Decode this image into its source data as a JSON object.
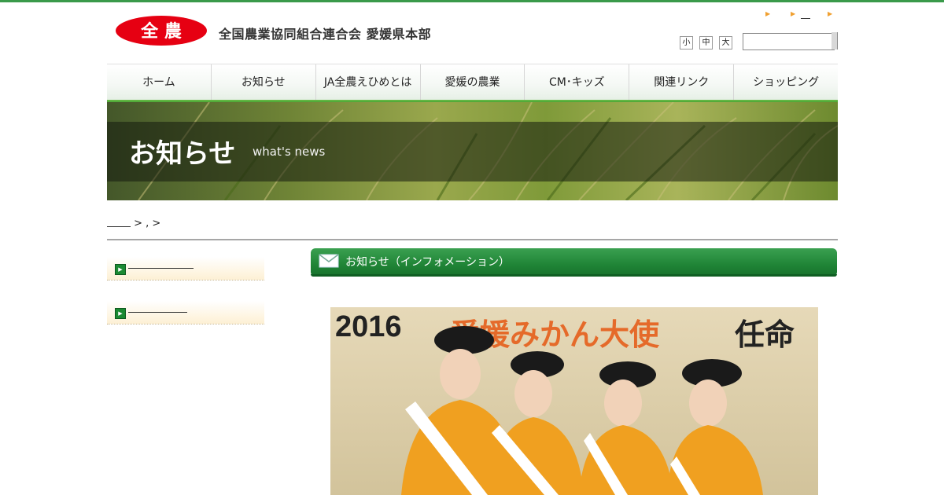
{
  "header": {
    "logo_text": "全 農",
    "org_name": "全国農業協同組合連合会 愛媛県本部",
    "font_size_label": [
      "小",
      "中",
      "大"
    ],
    "search_placeholder": ""
  },
  "nav": {
    "items": [
      "ホーム",
      "お知らせ",
      "JA全農えひめとは",
      "愛媛の農業",
      "CM･キッズ",
      "関連リンク",
      "ショッピング"
    ]
  },
  "banner": {
    "title": "お知らせ",
    "subtitle": "what's news"
  },
  "breadcrumb": {
    "separator_text": " > , >"
  },
  "main": {
    "section_title": "お知らせ（インフォメーション）",
    "photo_caption_number": "2016",
    "photo_caption_red": "愛媛みかん大使",
    "photo_caption_black": "任命"
  },
  "colors": {
    "brand_green": "#1f8436",
    "brand_red": "#e60012",
    "accent_orange": "#f0a030"
  }
}
